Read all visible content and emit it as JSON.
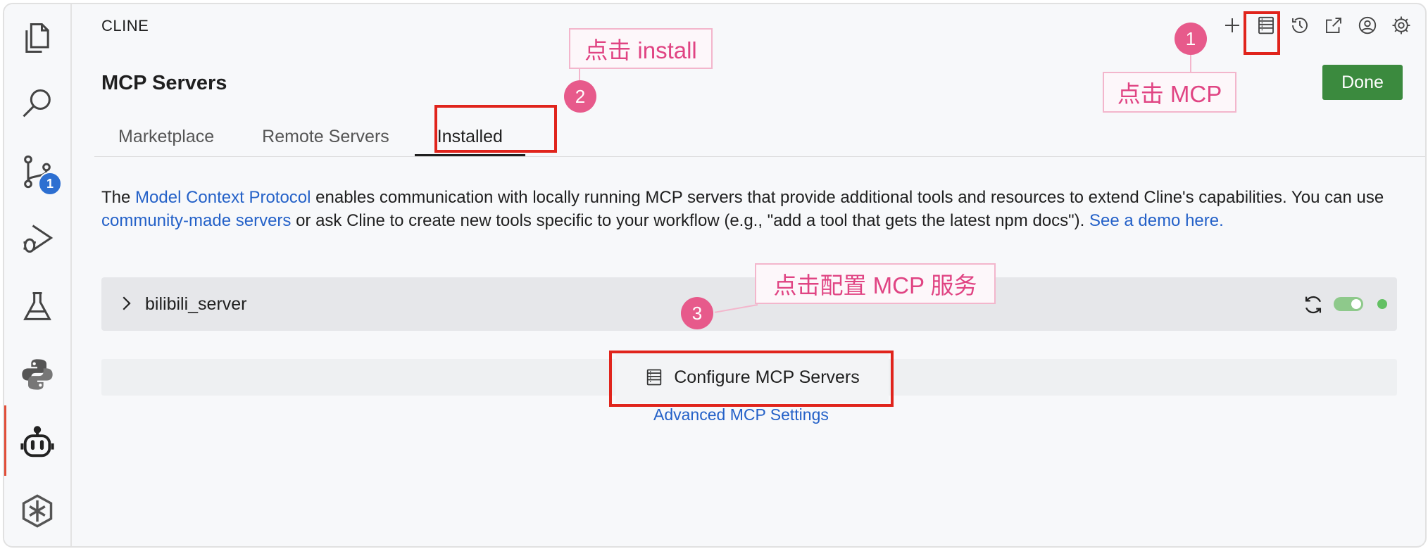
{
  "sidebar": {
    "items": [
      {
        "name": "explorer",
        "icon": "files-icon"
      },
      {
        "name": "search",
        "icon": "search-icon"
      },
      {
        "name": "source-control",
        "icon": "source-control-icon",
        "badge": "1"
      },
      {
        "name": "run-debug",
        "icon": "run-debug-icon"
      },
      {
        "name": "testing",
        "icon": "flask-icon"
      },
      {
        "name": "python",
        "icon": "python-icon"
      },
      {
        "name": "cline",
        "icon": "robot-icon"
      },
      {
        "name": "qwen",
        "icon": "qwen-icon"
      }
    ]
  },
  "header": {
    "panel_title": "CLINE",
    "toolbar_icons": [
      "plus-icon",
      "server-icon",
      "history-icon",
      "popout-icon",
      "account-icon",
      "gear-icon"
    ]
  },
  "page": {
    "title": "MCP Servers",
    "done_label": "Done",
    "tabs": [
      {
        "label": "Marketplace",
        "active": false
      },
      {
        "label": "Remote Servers",
        "active": false
      },
      {
        "label": "Installed",
        "active": true
      }
    ],
    "description": {
      "t1": "The ",
      "link1": "Model Context Protocol",
      "t2": " enables communication with locally running MCP servers that provide additional tools and resources to extend Cline's capabilities. You can use ",
      "link2": "community-made servers",
      "t3": " or ask Cline to create new tools specific to your workflow (e.g., \"add a tool that gets the latest npm docs\"). ",
      "link3": "See a demo here."
    },
    "servers": [
      {
        "name": "bilibili_server",
        "enabled": true,
        "status": "connected"
      }
    ],
    "configure_label": "Configure MCP Servers",
    "advanced_link": "Advanced MCP Settings"
  },
  "annotations": {
    "step1": {
      "number": "1",
      "text": "点击 MCP"
    },
    "step2": {
      "number": "2",
      "text": "点击 install"
    },
    "step3": {
      "number": "3",
      "text": "点击配置 MCP 服务"
    }
  },
  "colors": {
    "accent_link": "#2461c8",
    "done_button": "#3b8a3e",
    "annotation_red": "#e0241c",
    "annotation_pink": "#e75a8b",
    "badge_blue": "#2d6fd1"
  }
}
